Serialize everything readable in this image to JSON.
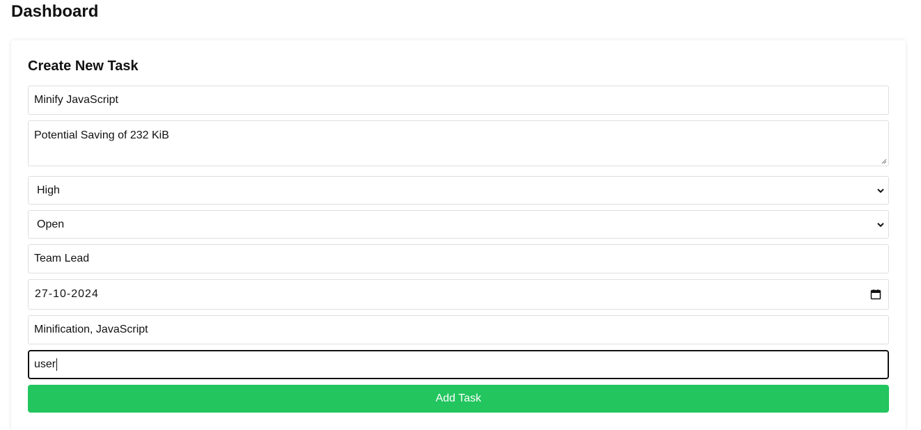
{
  "page": {
    "title": "Dashboard"
  },
  "form": {
    "title": "Create New Task",
    "task_title": "Minify JavaScript",
    "description": "Potential Saving of 232 KiB",
    "priority": "High",
    "status": "Open",
    "assignee": "Team Lead",
    "due_date": "27-10-2024",
    "tags": "Minification, JavaScript",
    "user": "user",
    "submit_label": "Add Task"
  },
  "colors": {
    "submit_bg": "#22c55e",
    "border": "#dedede",
    "focus_border": "#111111"
  },
  "icons": {
    "select_arrow": "chevron-down-icon",
    "date_picker": "calendar-icon"
  }
}
